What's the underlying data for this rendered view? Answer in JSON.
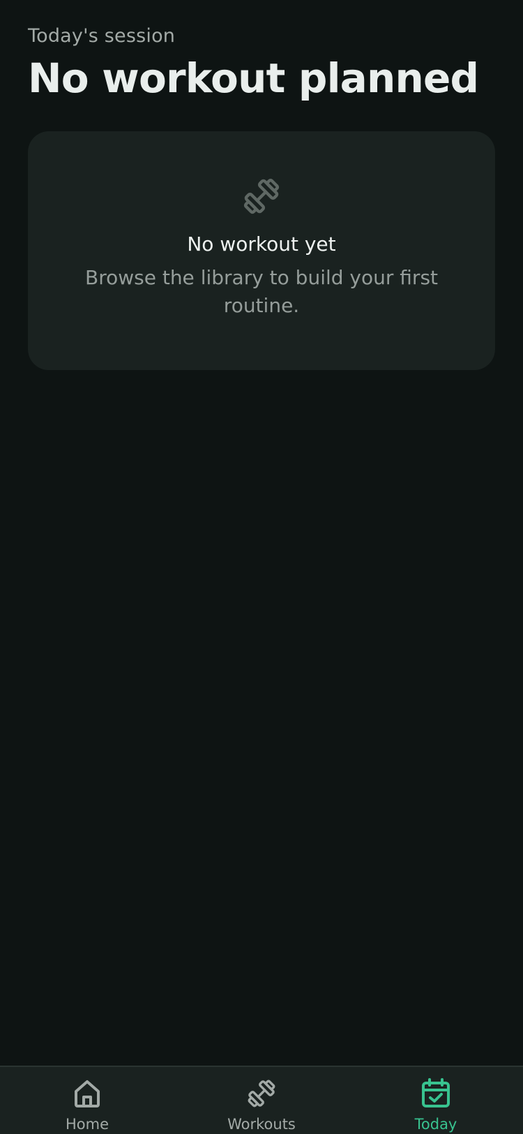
{
  "header": {
    "subtitle": "Today's session",
    "title": "No workout planned"
  },
  "empty_state": {
    "icon": "dumbbell-icon",
    "heading": "No workout yet",
    "text": "Browse the library to build your first routine."
  },
  "nav": {
    "items": [
      {
        "label": "Home",
        "icon": "home-icon",
        "active": false
      },
      {
        "label": "Workouts",
        "icon": "dumbbell-icon",
        "active": false
      },
      {
        "label": "Today",
        "icon": "calendar-check-icon",
        "active": true
      }
    ]
  },
  "colors": {
    "background": "#0e1413",
    "card": "#1a2220",
    "accent": "#38c28f",
    "muted_text": "#a3aaa7"
  }
}
